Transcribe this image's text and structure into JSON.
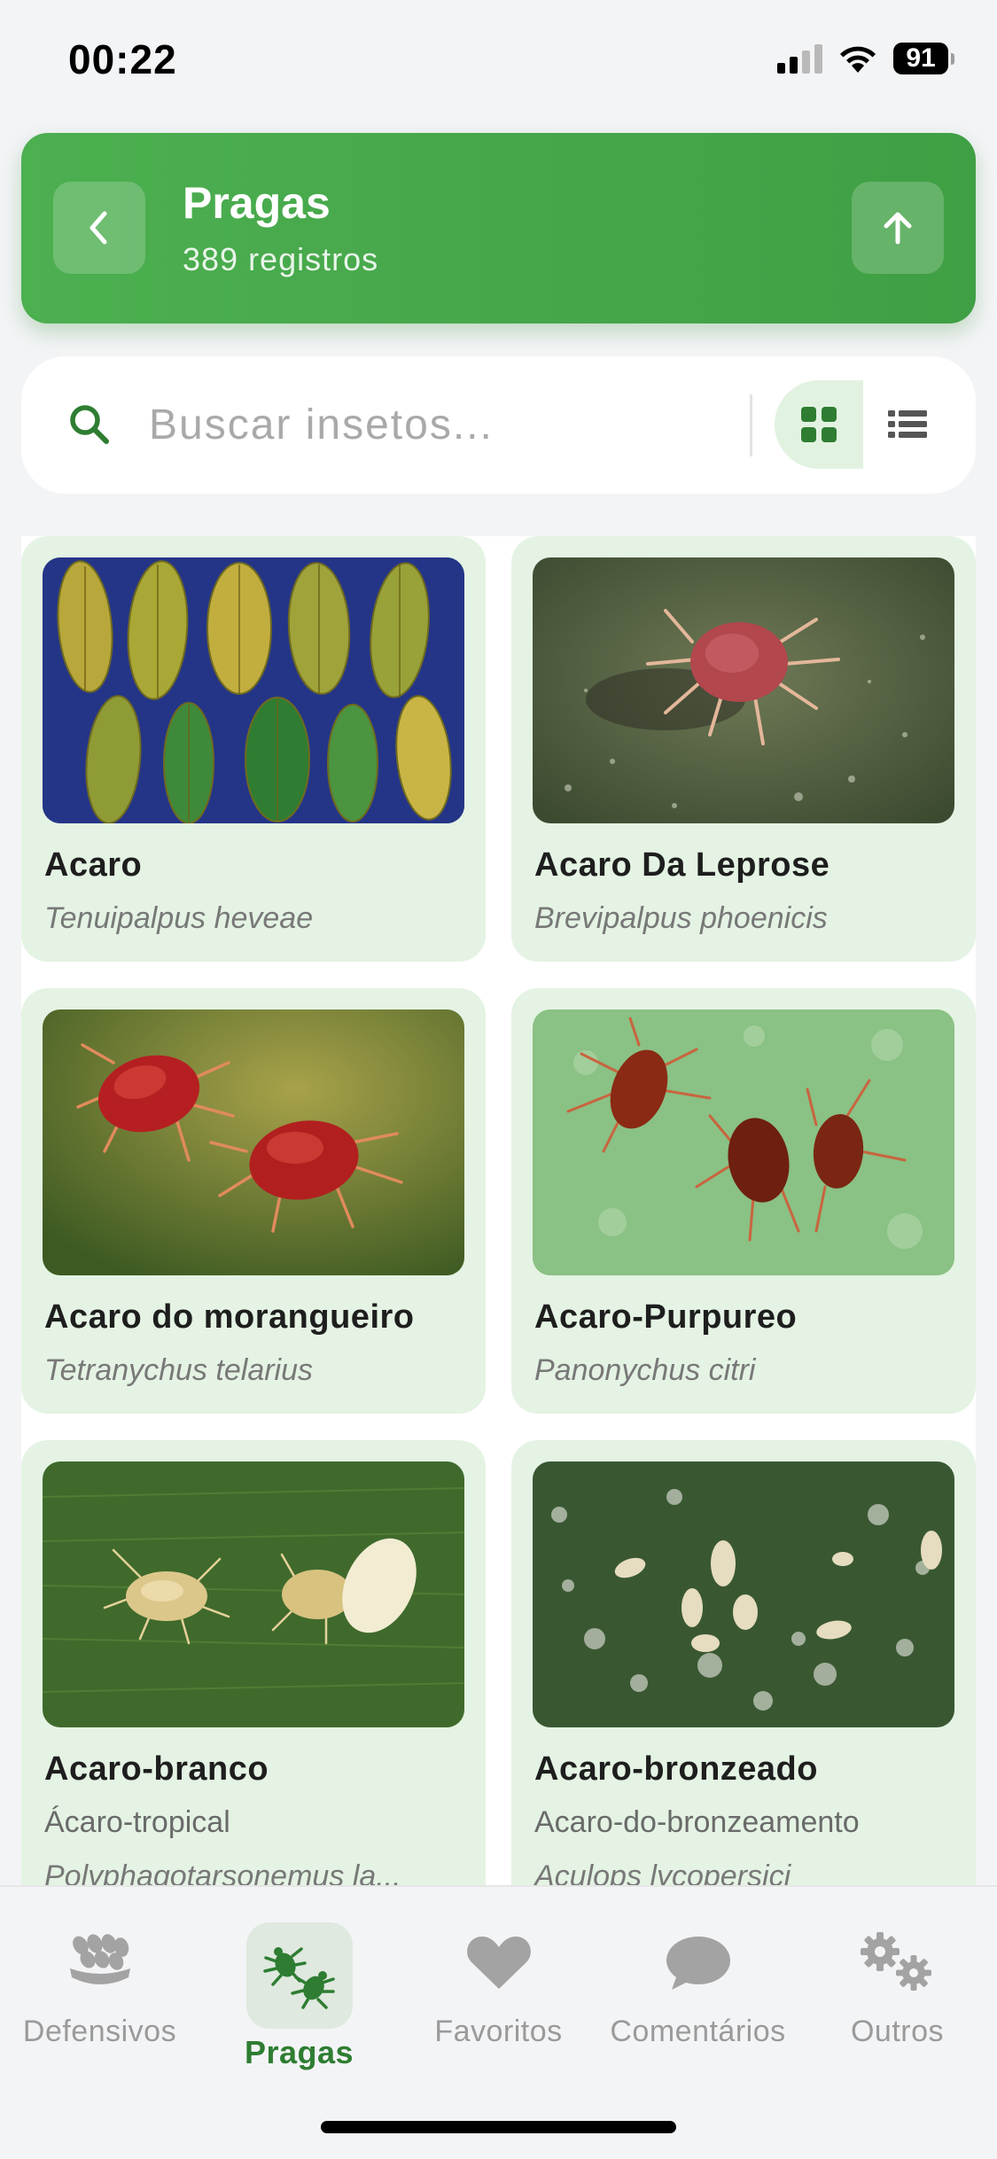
{
  "status_bar": {
    "time": "00:22",
    "battery": "91"
  },
  "header": {
    "title": "Pragas",
    "subtitle": "389 registros"
  },
  "search": {
    "placeholder": "Buscar insetos...",
    "value": ""
  },
  "colors": {
    "primary": "#4caf50",
    "primary_dark": "#2e7d32",
    "card_bg": "#e4f3e3",
    "nav_active_bg": "#dfe9df"
  },
  "cards": [
    {
      "name": "Acaro",
      "scientific": "Tenuipalpus heveae"
    },
    {
      "name": "Acaro Da Leprose",
      "scientific": "Brevipalpus phoenicis"
    },
    {
      "name": "Acaro do morangueiro",
      "scientific": "Tetranychus telarius"
    },
    {
      "name": "Acaro-Purpureo",
      "scientific": "Panonychus citri"
    },
    {
      "name": "Acaro-branco",
      "common": "Ácaro-tropical",
      "scientific": "Polyphagotarsonemus la..."
    },
    {
      "name": "Acaro-bronzeado",
      "common": "Acaro-do-bronzeamento",
      "scientific": "Aculops lycopersici"
    }
  ],
  "nav": {
    "items": [
      {
        "label": "Defensivos",
        "icon": "wheat-icon",
        "active": false
      },
      {
        "label": "Pragas",
        "icon": "bugs-icon",
        "active": true
      },
      {
        "label": "Favoritos",
        "icon": "heart-icon",
        "active": false
      },
      {
        "label": "Comentários",
        "icon": "comment-icon",
        "active": false
      },
      {
        "label": "Outros",
        "icon": "gears-icon",
        "active": false
      }
    ]
  }
}
